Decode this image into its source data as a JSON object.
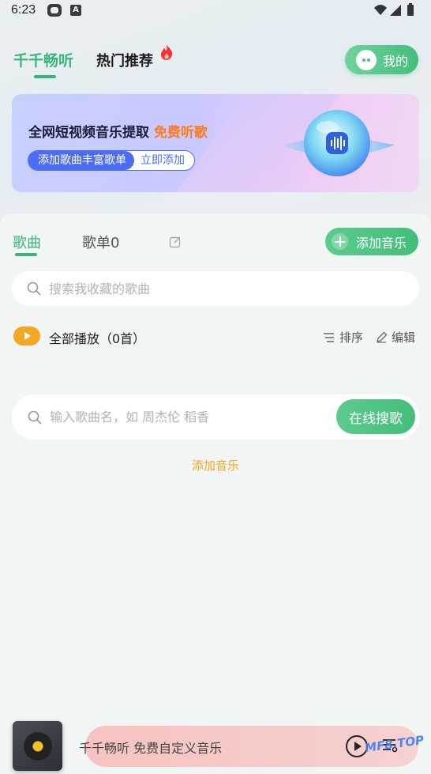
{
  "status_bar": {
    "time": "6:23",
    "small_icon_letter": "A"
  },
  "header": {
    "tab_main": "千千畅听",
    "tab_hot": "热门推荐",
    "my_button": "我的"
  },
  "banner": {
    "title_main": "全网短视频音乐提取",
    "title_highlight": "免费听歌",
    "pill_left": "添加歌曲丰富歌单",
    "pill_right": "立即添加"
  },
  "segments": {
    "songs": "歌曲",
    "playlists": "歌单0",
    "add_music_button": "添加音乐"
  },
  "fav_search": {
    "placeholder": "搜索我收藏的歌曲"
  },
  "play_all": {
    "label": "全部播放（0首）",
    "sort": "排序",
    "edit": "编辑"
  },
  "online_search": {
    "placeholder": "输入歌曲名，如 周杰伦 稻香",
    "button": "在线搜歌"
  },
  "add_music_link": "添加音乐",
  "player": {
    "text": "千千畅听 免费自定义音乐"
  },
  "watermark": "MF8.TOP",
  "colors": {
    "accent_green": "#3bb478",
    "accent_orange": "#f5a623",
    "banner_blue": "#4c6cf5"
  }
}
